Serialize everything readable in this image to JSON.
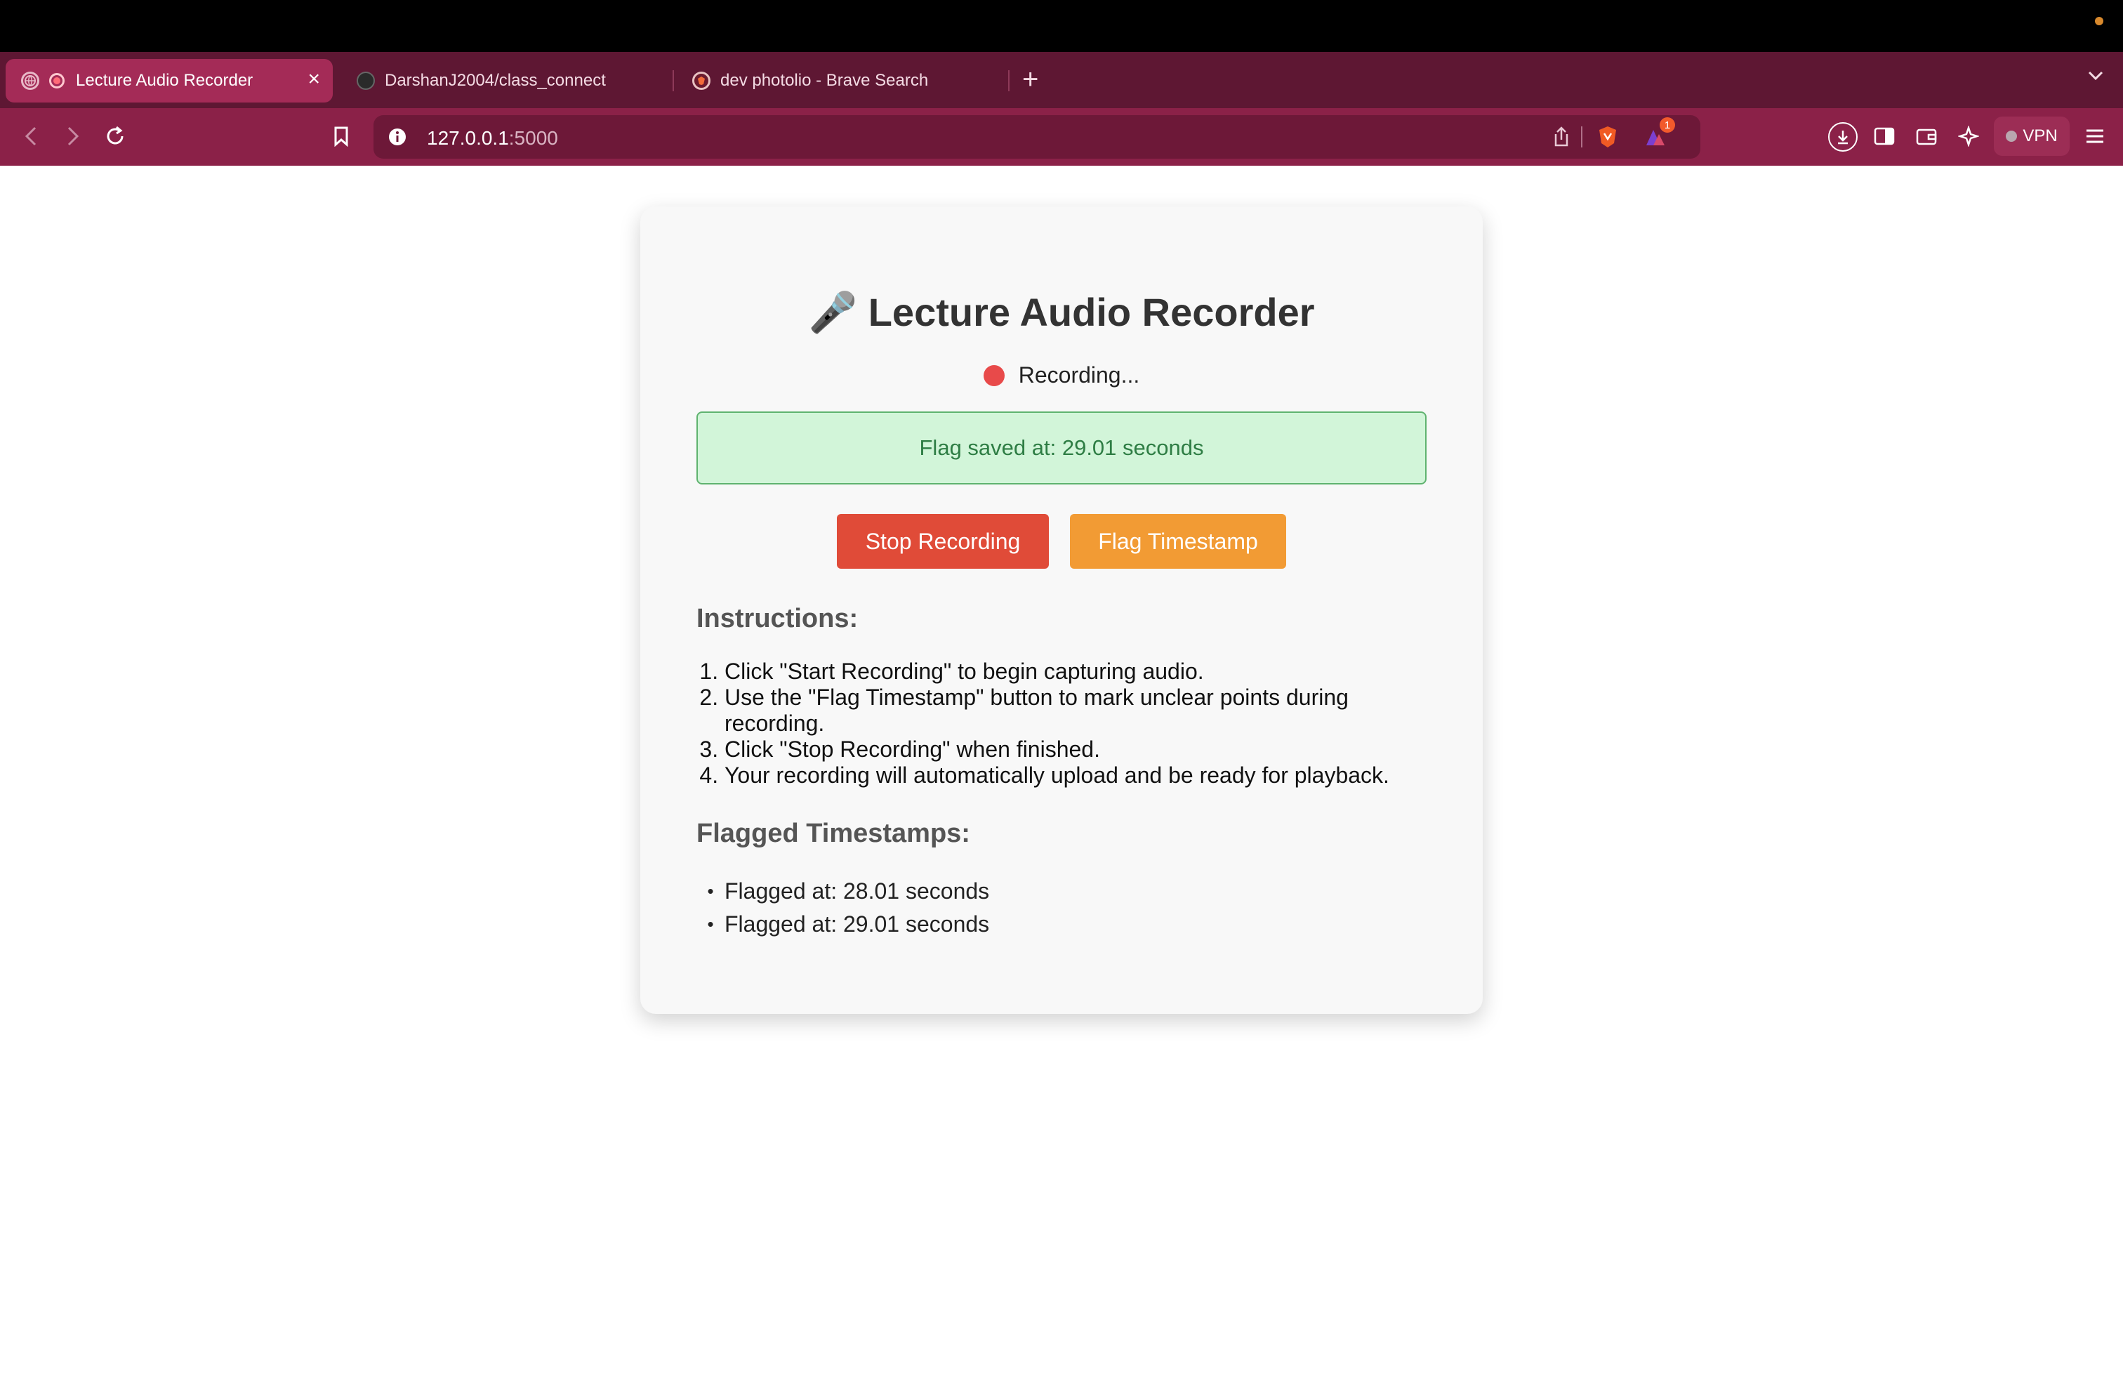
{
  "browser": {
    "tabs": [
      {
        "label": "Lecture Audio Recorder",
        "active": true
      },
      {
        "label": "DarshanJ2004/class_connect",
        "active": false
      },
      {
        "label": "dev photolio - Brave Search",
        "active": false
      }
    ],
    "new_tab": "+",
    "close_tab": "×",
    "url_host": "127.0.0.1",
    "url_port": ":5000",
    "vpn_label": "VPN",
    "rewards_badge": "1",
    "accent": "#8b2148",
    "tabstrip_color": "#5e1733"
  },
  "app": {
    "title": "🎤 Lecture Audio Recorder",
    "status": "Recording...",
    "alert": "Flag saved at: 29.01 seconds",
    "stop_button": "Stop Recording",
    "flag_button": "Flag Timestamp",
    "instructions_heading": "Instructions:",
    "instructions": [
      "Click \"Start Recording\" to begin capturing audio.",
      "Use the \"Flag Timestamp\" button to mark unclear points during recording.",
      "Click \"Stop Recording\" when finished.",
      "Your recording will automatically upload and be ready for playback."
    ],
    "flags_heading": "Flagged Timestamps:",
    "flags": [
      "Flagged at: 28.01 seconds",
      "Flagged at: 29.01 seconds"
    ],
    "colors": {
      "stop": "#e04b38",
      "flag": "#f29b34",
      "recording_dot": "#e84a4a",
      "alert_bg": "#d2f5d9",
      "alert_text": "#2e7d44"
    }
  }
}
